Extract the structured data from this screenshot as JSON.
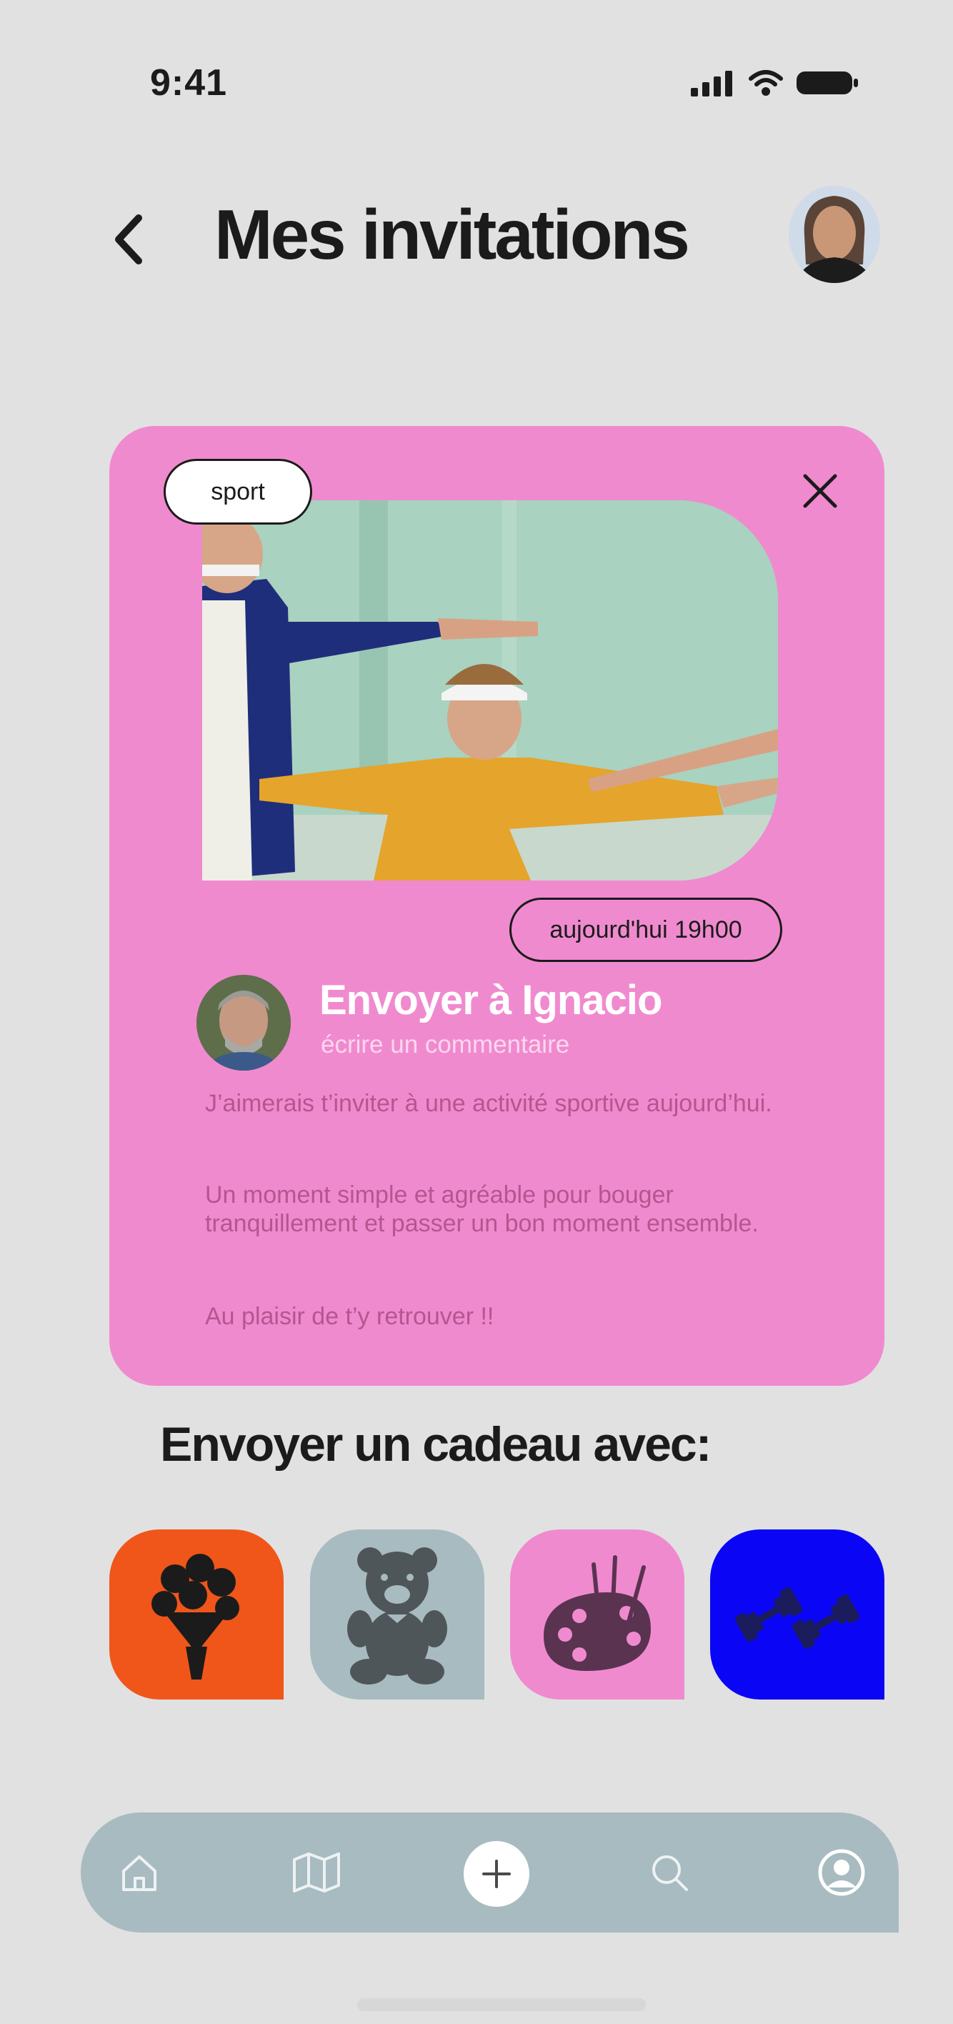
{
  "status_bar": {
    "time": "9:41"
  },
  "header": {
    "title": "Mes invitations"
  },
  "invitation": {
    "tag": "sport",
    "datetime": "aujourd'hui 19h00",
    "send_title": "Envoyer à Ignacio",
    "comment_placeholder": "écrire un commentaire",
    "message": [
      "J’aimerais t’inviter à une activité sportive aujourd’hui.",
      "Un moment simple et agréable pour bouger tranquillement et passer un bon moment ensemble.",
      "Au plaisir de t’y retrouver !!"
    ]
  },
  "gifts": {
    "title": "Envoyer un cadeau avec:",
    "items": [
      {
        "icon": "bouquet-icon",
        "color": "#f0561a"
      },
      {
        "icon": "teddy-bear-icon",
        "color": "#a7bbc0"
      },
      {
        "icon": "paint-palette-icon",
        "color": "#f08acf"
      },
      {
        "icon": "dumbbells-icon",
        "color": "#0a06f5"
      }
    ]
  },
  "nav": {
    "items": [
      "home-icon",
      "map-icon",
      "add-icon",
      "search-icon",
      "profile-icon"
    ]
  },
  "colors": {
    "background": "#e1e1e1",
    "card": "#f08acf",
    "navbar": "#a7bbc0"
  }
}
